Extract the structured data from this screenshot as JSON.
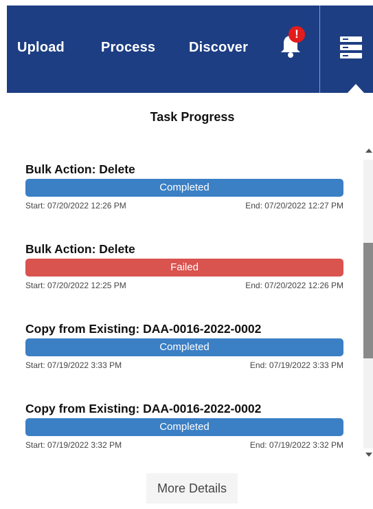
{
  "nav": {
    "upload": "Upload",
    "process": "Process",
    "discover": "Discover",
    "notification_badge": "!",
    "bell_icon": "bell-icon",
    "menu_icon": "server-stack-icon",
    "background_color": "#1d3e83"
  },
  "panel": {
    "title": "Task Progress",
    "more_details": "More Details"
  },
  "tasks": [
    {
      "title": "Bulk Action: Delete",
      "status": "Completed",
      "start": "Start: 07/20/2022 12:26 PM",
      "end": "End: 07/20/2022 12:27 PM"
    },
    {
      "title": "Bulk Action: Delete",
      "status": "Failed",
      "start": "Start: 07/20/2022 12:25 PM",
      "end": "End: 07/20/2022 12:26 PM"
    },
    {
      "title": "Copy from Existing: DAA-0016-2022-0002",
      "status": "Completed",
      "start": "Start: 07/19/2022 3:33 PM",
      "end": "End: 07/19/2022 3:33 PM"
    },
    {
      "title": "Copy from Existing: DAA-0016-2022-0002",
      "status": "Completed",
      "start": "Start: 07/19/2022 3:32 PM",
      "end": "End: 07/19/2022 3:32 PM"
    }
  ],
  "colors": {
    "completed": "#3b7fc4",
    "failed": "#d9534f",
    "alert": "#e21c1c"
  }
}
